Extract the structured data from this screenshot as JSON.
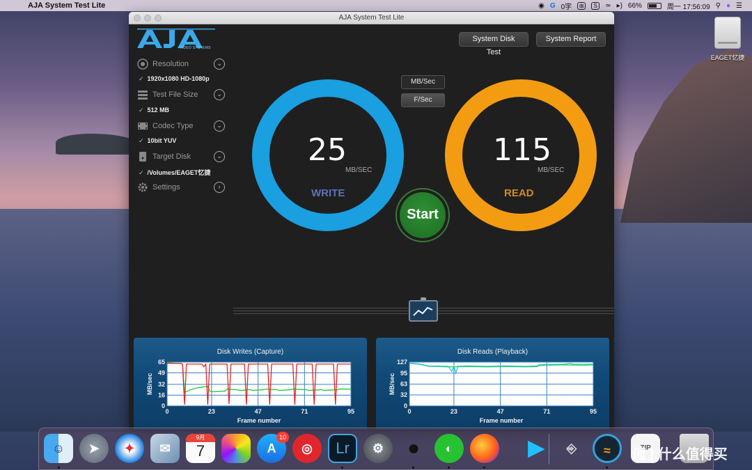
{
  "menubar": {
    "app_name": "AJA System Test Lite",
    "input_method": "0字",
    "battery": "66%",
    "clock": "周一 17:56:09"
  },
  "desktop": {
    "drive_label": "EAGET忆捷"
  },
  "window": {
    "title": "AJA System Test Lite",
    "logo_sub": "VIDEO SYSTEMS",
    "buttons": {
      "system_disk_test": "System Disk Test",
      "system_report": "System Report"
    }
  },
  "settings": {
    "resolution": {
      "label": "Resolution",
      "value": "1920x1080 HD-1080p"
    },
    "test_file_size": {
      "label": "Test File Size",
      "value": "512 MB"
    },
    "codec_type": {
      "label": "Codec Type",
      "value": "10bit YUV"
    },
    "target_disk": {
      "label": "Target Disk",
      "value": "/Volumes/EAGET忆捷"
    },
    "settings_label": "Settings"
  },
  "units": {
    "mb_sec": "MB/Sec",
    "f_sec": "F/Sec"
  },
  "write": {
    "value": "25",
    "unit": "MB/SEC",
    "label": "WRITE"
  },
  "read": {
    "value": "115",
    "unit": "MB/SEC",
    "label": "READ"
  },
  "start_label": "Start",
  "chart_data": [
    {
      "type": "line",
      "title": "Disk Writes (Capture)",
      "xlabel": "Frame number",
      "ylabel": "MB/sec",
      "xlim": [
        0,
        95
      ],
      "ylim": [
        0,
        65
      ],
      "x_ticks": [
        0,
        23,
        47,
        71,
        95
      ],
      "y_ticks": [
        0,
        16,
        32,
        49,
        65
      ],
      "series": [
        {
          "color": "#22cc33",
          "x": [
            0,
            6,
            8,
            9,
            12,
            16,
            21,
            22,
            24,
            30,
            31,
            36,
            38,
            43,
            44,
            50,
            51,
            57,
            58,
            64,
            65,
            72,
            73,
            80,
            81,
            88,
            89,
            95
          ],
          "y": [
            64,
            63,
            62,
            20,
            24,
            27,
            29,
            22,
            21,
            22,
            25,
            24,
            23,
            24,
            23,
            24,
            25,
            24,
            23,
            24,
            25,
            24,
            23,
            24,
            23,
            24,
            25,
            25
          ]
        },
        {
          "color": "#e02424",
          "x": [
            0,
            7,
            8,
            9,
            10,
            18,
            19,
            20,
            21,
            22,
            31,
            32,
            33,
            34,
            40,
            41,
            42,
            43,
            44,
            52,
            53,
            54,
            55,
            65,
            66,
            67,
            68,
            75,
            76,
            77,
            78,
            86,
            87,
            88,
            89,
            95
          ],
          "y": [
            63,
            63,
            62,
            2,
            62,
            62,
            58,
            62,
            2,
            62,
            62,
            3,
            62,
            62,
            62,
            2,
            62,
            62,
            62,
            62,
            2,
            62,
            62,
            62,
            2,
            62,
            62,
            62,
            2,
            62,
            62,
            62,
            2,
            62,
            62,
            62
          ]
        }
      ]
    },
    {
      "type": "line",
      "title": "Disk Reads (Playback)",
      "xlabel": "Frame number",
      "ylabel": "MB/sec",
      "xlim": [
        0,
        95
      ],
      "ylim": [
        0,
        127
      ],
      "x_ticks": [
        0,
        23,
        47,
        71,
        95
      ],
      "y_ticks": [
        0,
        32,
        63,
        95,
        127
      ],
      "series": [
        {
          "color": "#22cc33",
          "x": [
            0,
            5,
            10,
            20,
            30,
            40,
            50,
            60,
            66,
            67,
            70,
            80,
            90,
            95
          ],
          "y": [
            123,
            121,
            115,
            113,
            114,
            113,
            114,
            113,
            114,
            117,
            118,
            119,
            118,
            119
          ]
        },
        {
          "color": "#2ec4e6",
          "x": [
            0,
            5,
            10,
            20,
            22,
            23,
            24,
            25,
            30,
            40,
            50,
            60,
            66,
            67,
            70,
            80,
            83,
            85,
            90,
            95
          ],
          "y": [
            124,
            122,
            116,
            115,
            100,
            116,
            95,
            115,
            116,
            115,
            116,
            115,
            116,
            119,
            120,
            121,
            123,
            121,
            121,
            121
          ]
        }
      ]
    }
  ],
  "dock": {
    "calendar_month": "9月",
    "calendar_day": "7",
    "appstore_badge": "10",
    "lightroom_text": "Lr"
  },
  "watermark": "值 | 什么值得买"
}
